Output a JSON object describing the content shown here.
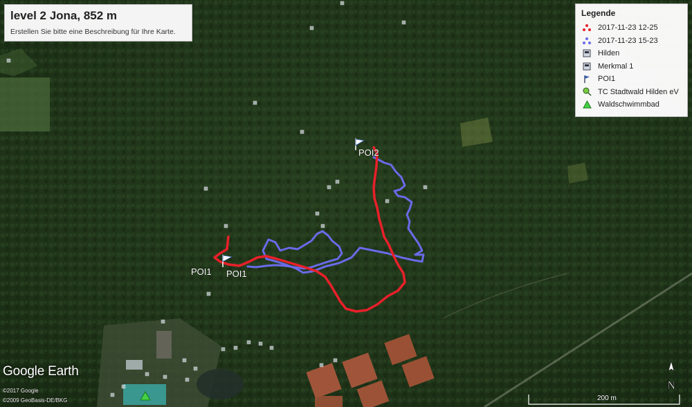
{
  "map": {
    "title": "level 2 Jona, 852 m",
    "subtitle": "Erstellen Sie bitte eine Beschreibung für Ihre Karte.",
    "legend": {
      "heading": "Legende",
      "items": [
        {
          "label": "2017-11-23 12-25",
          "icon": "red-dots-icon",
          "color": "#e8202a"
        },
        {
          "label": "2017-11-23 15-23",
          "icon": "blue-dots-icon",
          "color": "#6a6ae8"
        },
        {
          "label": "Hilden",
          "icon": "placemark-square-icon"
        },
        {
          "label": "Merkmal 1",
          "icon": "placemark-square-icon"
        },
        {
          "label": "POI1",
          "icon": "flag-icon"
        },
        {
          "label": "TC Stadtwald Hilden eV",
          "icon": "tennis-icon"
        },
        {
          "label": "Waldschwimmbad",
          "icon": "tree-icon"
        }
      ]
    },
    "poi_labels": [
      "POI2",
      "POI1",
      "POI1"
    ],
    "track_colors": {
      "red": "#e8202a",
      "blue": "#6a6ae8"
    },
    "branding": "Google Earth",
    "copyright1": "©2017 Google",
    "copyright2": "©2009 GeoBasis-DE/BKG",
    "north_label": "N",
    "scale_label": "200 m"
  }
}
